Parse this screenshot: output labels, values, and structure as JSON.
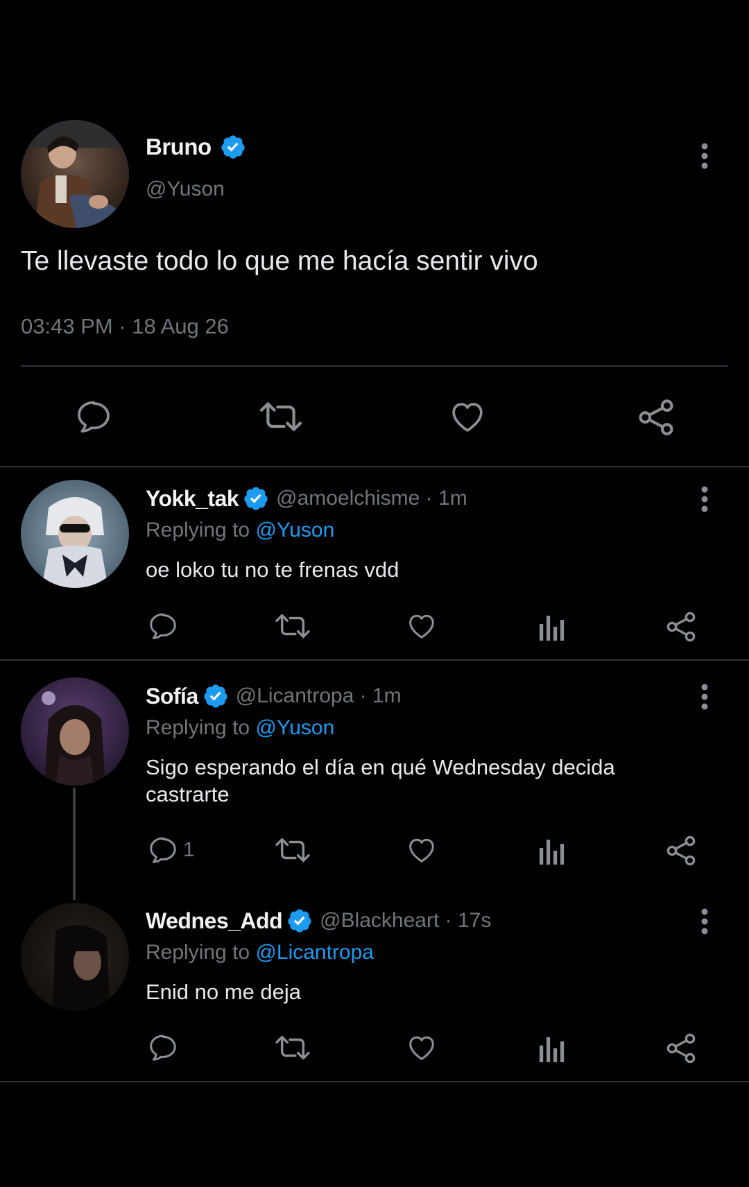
{
  "main_tweet": {
    "display_name": "Bruno",
    "handle": "@Yuson",
    "text": "Te llevaste todo lo que me hacía sentir vivo",
    "timestamp": "03:43 PM · 18 Aug 26",
    "icons": [
      "reply-icon",
      "retweet-icon",
      "like-icon",
      "share-icon"
    ]
  },
  "replies": [
    {
      "display_name": "Yokk_tak",
      "meta": "@amoelchisme · 1m",
      "replying_prefix": "Replying to",
      "replying_to": "@Yuson",
      "text": "oe loko tu no te frenas vdd",
      "reply_count": ""
    },
    {
      "display_name": "Sofía",
      "meta": "@Licantropa · 1m",
      "replying_prefix": "Replying to",
      "replying_to": "@Yuson",
      "text": "Sigo esperando el día en qué Wednesday decida castrarte",
      "reply_count": "1"
    },
    {
      "display_name": "Wednes_Add",
      "meta": "@Blackheart · 17s",
      "replying_prefix": "Replying to",
      "replying_to": "@Licantropa",
      "text": "Enid no me deja",
      "reply_count": ""
    }
  ],
  "colors": {
    "background": "#000000",
    "text": "#e7e9ea",
    "muted": "#71767b",
    "accent": "#1d9bf0",
    "verified": "#1d9bf0",
    "divider": "#2f3336"
  }
}
